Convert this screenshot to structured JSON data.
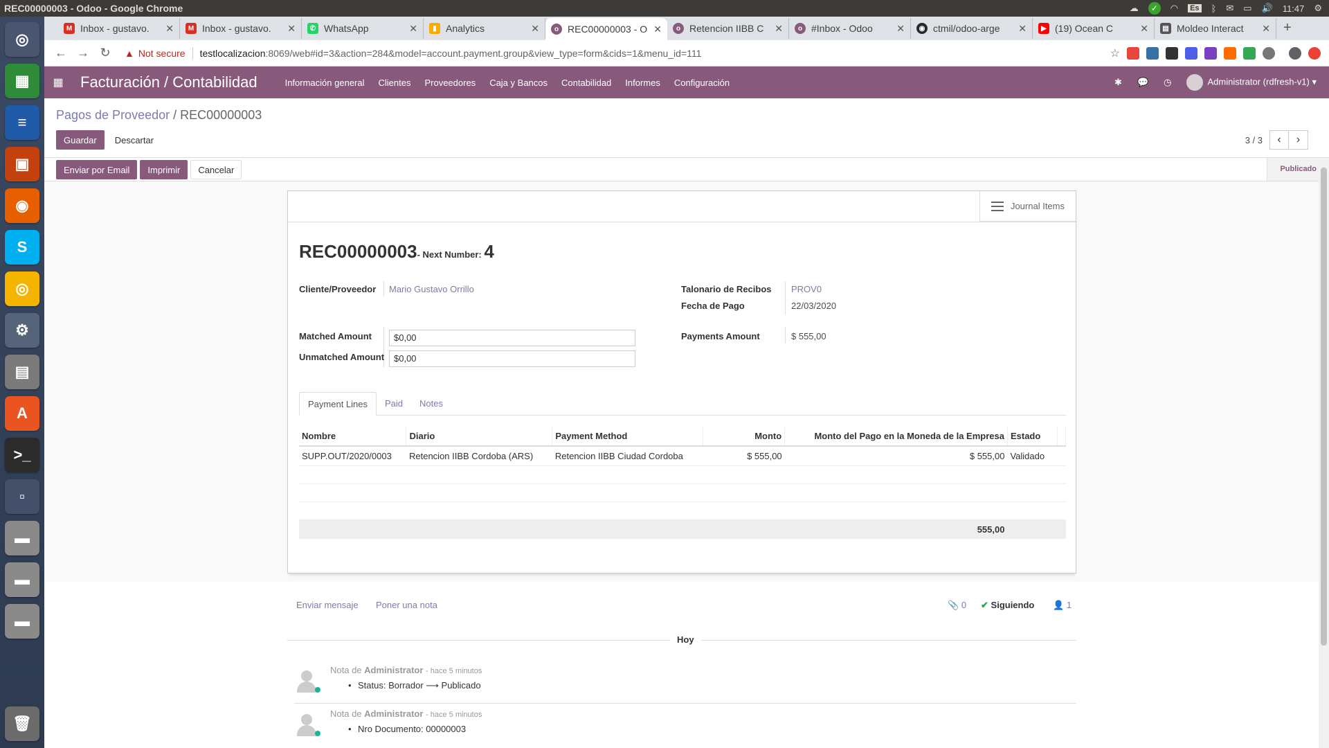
{
  "window_title": "REC00000003 - Odoo - Google Chrome",
  "tray": {
    "lang": "Es",
    "time": "11:47"
  },
  "tabs": [
    {
      "label": "Inbox - gustavo.",
      "icon": "gmail-icon",
      "color": "#d93025"
    },
    {
      "label": "Inbox - gustavo.",
      "icon": "gmail-icon",
      "color": "#d93025"
    },
    {
      "label": "WhatsApp",
      "icon": "whatsapp-icon",
      "color": "#25d366"
    },
    {
      "label": "Analytics",
      "icon": "analytics-icon",
      "color": "#f9ab00"
    },
    {
      "label": "REC00000003 - O",
      "icon": "odoo-icon",
      "color": "#875a7b"
    },
    {
      "label": "Retencion IIBB C",
      "icon": "odoo-icon",
      "color": "#875a7b"
    },
    {
      "label": "#Inbox - Odoo",
      "icon": "odoo-icon",
      "color": "#875a7b"
    },
    {
      "label": "ctmil/odoo-arge",
      "icon": "github-icon",
      "color": "#24292e"
    },
    {
      "label": "(19) Ocean C",
      "icon": "youtube-icon",
      "color": "#ff0000"
    },
    {
      "label": "Moldeo Interact",
      "icon": "page-icon",
      "color": "#555555"
    }
  ],
  "address": {
    "not_secure": "Not secure",
    "host": "testlocalizacion",
    "rest": ":8069/web#id=3&action=284&model=account.payment.group&view_type=form&cids=1&menu_id=111"
  },
  "odoo_nav": {
    "app": "Facturación / Contabilidad",
    "menu": [
      "Información general",
      "Clientes",
      "Proveedores",
      "Caja y Bancos",
      "Contabilidad",
      "Informes",
      "Configuración"
    ],
    "user": "Administrator (rdfresh-v1)"
  },
  "breadcrumb": {
    "parent": "Pagos de Proveedor",
    "sep": "/",
    "current": "REC00000003"
  },
  "buttons": {
    "save": "Guardar",
    "discard": "Descartar",
    "email": "Enviar por Email",
    "print": "Imprimir",
    "cancel": "Cancelar"
  },
  "pager": "3 / 3",
  "status": "Publicado",
  "smart_button": "Journal Items",
  "form": {
    "name": "REC00000003",
    "next_label": "- Next Number:",
    "next_value": "4",
    "partner_label": "Cliente/Proveedor",
    "partner_value": "Mario Gustavo Orrillo",
    "receiptbook_label": "Talonario de Recibos",
    "receiptbook_value": "PROV0",
    "date_label": "Fecha de Pago",
    "date_value": "22/03/2020",
    "matched_label": "Matched Amount",
    "matched_value": "$0,00",
    "unmatched_label": "Unmatched Amount",
    "unmatched_value": "$0,00",
    "payments_label": "Payments Amount",
    "payments_value": "$ 555,00"
  },
  "notebook": {
    "tabs": [
      "Payment Lines",
      "Paid",
      "Notes"
    ]
  },
  "table": {
    "headers": [
      "Nombre",
      "Diario",
      "Payment Method",
      "Monto",
      "Monto del Pago en la Moneda de la Empresa",
      "Estado"
    ],
    "rows": [
      [
        "SUPP.OUT/2020/0003",
        "Retencion IIBB Cordoba (ARS)",
        "Retencion IIBB Ciudad Cordoba",
        "$ 555,00",
        "$ 555,00",
        "Validado"
      ]
    ],
    "total": "555,00"
  },
  "chatter": {
    "send": "Enviar mensaje",
    "note": "Poner una nota",
    "attachments": "0",
    "following": "Siguiendo",
    "followers": "1",
    "date_sep": "Hoy",
    "messages": [
      {
        "prefix": "Nota de",
        "author": "Administrator",
        "time": "- hace 5 minutos",
        "body": "Status: Borrador ⟶ Publicado"
      },
      {
        "prefix": "Nota de",
        "author": "Administrator",
        "time": "- hace 5 minutos",
        "body": "Nro Documento: 00000003"
      }
    ]
  }
}
